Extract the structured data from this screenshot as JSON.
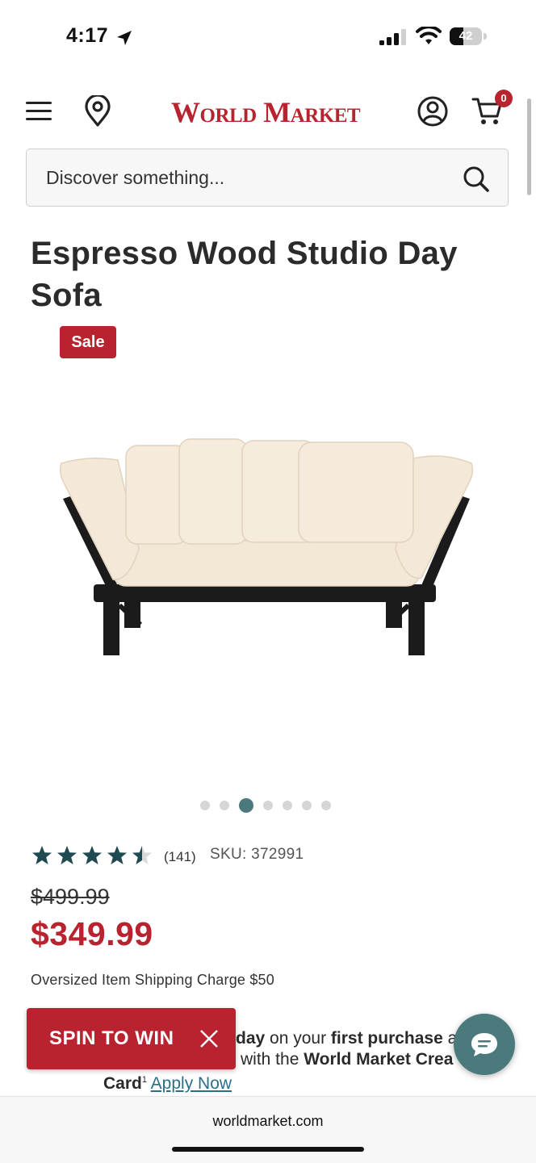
{
  "status_bar": {
    "time": "4:17",
    "battery": "42",
    "battery_level": 0.42
  },
  "header": {
    "logo": "World Market",
    "cart_count": "0",
    "icons": [
      "menu-icon",
      "location-pin-icon",
      "account-icon",
      "cart-icon"
    ]
  },
  "search": {
    "placeholder": "Discover something..."
  },
  "product": {
    "title": "Espresso Wood Studio Day Sofa",
    "badge": "Sale",
    "rating": 4.5,
    "review_count": "(141)",
    "sku": "SKU: 372991",
    "old_price": "$499.99",
    "price": "$349.99",
    "shipping": "Oversized Item Shipping Charge $50"
  },
  "carousel": {
    "count": 7,
    "active_index": 2
  },
  "promo": {
    "line1_bold_a": "day",
    "line1_text": " on your ",
    "line1_bold_b": "first purchase",
    "line1_tail": " a",
    "line2_text": "with the ",
    "line2_bold": "World Market Crea",
    "line3_bold": "Card",
    "line3_sup": "1",
    "apply_link": "Apply Now"
  },
  "spin_to_win": {
    "label": "SPIN TO WIN"
  },
  "browser": {
    "url": "worldmarket.com"
  },
  "colors": {
    "brand_red": "#b8232f",
    "teal": "#4a7a7c",
    "star": "#1f4a52"
  }
}
